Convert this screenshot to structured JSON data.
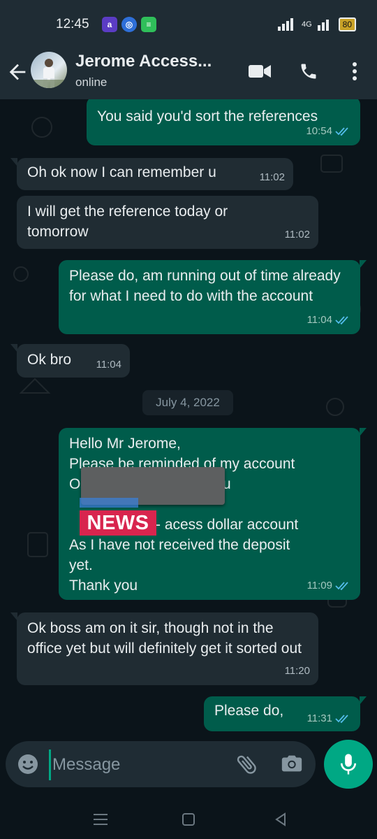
{
  "status_bar": {
    "time": "12:45",
    "network": "4G",
    "battery": "80"
  },
  "header": {
    "contact_name": "Jerome Access...",
    "status": "online"
  },
  "messages": [
    {
      "dir": "out",
      "text": "You said you'd sort the references",
      "time": "10:54"
    },
    {
      "dir": "in",
      "text": "Oh ok now I can remember u",
      "time": "11:02"
    },
    {
      "dir": "in",
      "text": "I will get the reference today or tomorrow",
      "time": "11:02"
    },
    {
      "dir": "out",
      "text": "Please do, am running out of time already for what I need to do with the account",
      "time": "11:04"
    },
    {
      "dir": "in",
      "text": "Ok bro",
      "time": "11:04"
    },
    {
      "dir": "out",
      "lines": [
        "Hello Mr Jerome,",
        "Please be reminded of my account",
        "O",
        "",
        "- acess dollar account",
        "As I have not received the deposit",
        "yet.",
        "Thank you"
      ],
      "line_tail_u": "u",
      "time": "11:09"
    },
    {
      "dir": "in",
      "text": "Ok boss am on it sir, though not in the office yet but will definitely get it sorted out",
      "time": "11:20"
    },
    {
      "dir": "out",
      "text": "Please do,",
      "time": "11:31"
    }
  ],
  "date_chip": "July 4, 2022",
  "overlay_stamp": "NEWS",
  "composer": {
    "placeholder": "Message"
  },
  "colors": {
    "outgoing_bubble": "#005c4b",
    "incoming_bubble": "#202c33",
    "accent": "#00a884",
    "read_ticks": "#53bdeb"
  }
}
